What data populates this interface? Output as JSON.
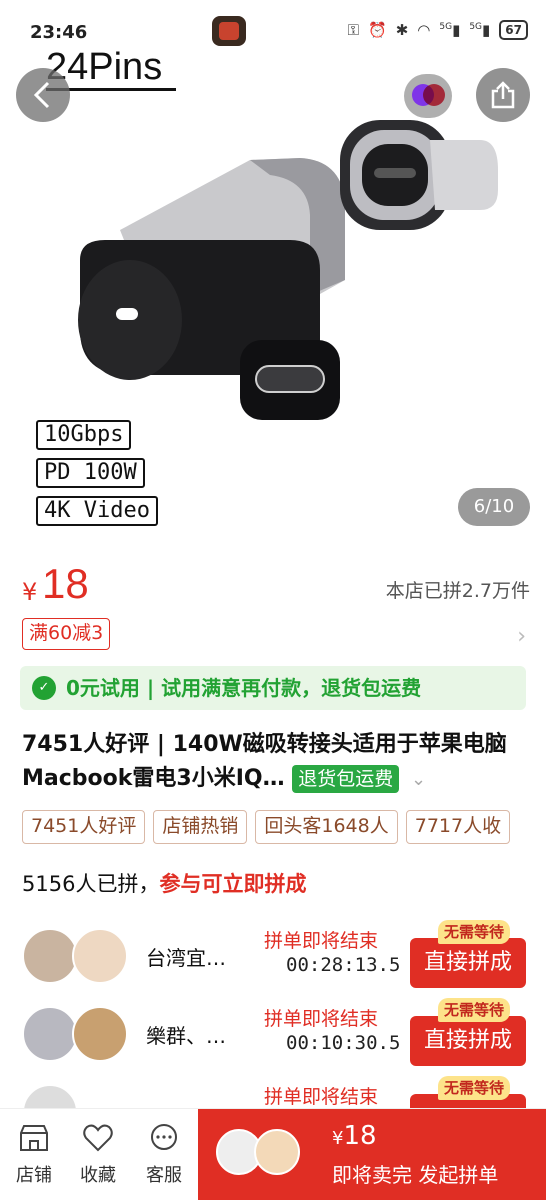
{
  "status_bar": {
    "time": "23:46",
    "battery": "67",
    "net1": "5G",
    "net2": "5G"
  },
  "gallery": {
    "overlay_title": "24Pins",
    "specs": [
      "10Gbps",
      "PD 100W",
      "4K Video"
    ],
    "pager": "6/10"
  },
  "price": {
    "currency": "¥",
    "amount": "18",
    "sold": "本店已拼2.7万件"
  },
  "coupon": "满60减3",
  "trial": {
    "label": "0元试用 | 试用满意再付款，退货包运费"
  },
  "product": {
    "title": "7451人好评 | 140W磁吸转接头适用于苹果电脑Macbook雷电3小米IQ…",
    "return_tag": "退货包运费"
  },
  "tags": [
    "7451人好评",
    "店铺热销",
    "回头客1648人",
    "7717人收"
  ],
  "group": {
    "count_text": "5156人已拼，",
    "cta_text": "参与可立即拼成",
    "rows": [
      {
        "name": "台湾宜…",
        "ending": "拼单即将结束",
        "timer": "00:28:13.5",
        "button": "直接拼成",
        "badge": "无需等待"
      },
      {
        "name": "樂群、…",
        "ending": "拼单即将结束",
        "timer": "00:10:30.5",
        "button": "直接拼成",
        "badge": "无需等待"
      },
      {
        "name": "",
        "ending": "拼单即将结束",
        "timer": "",
        "button": "",
        "badge": "无需等待"
      }
    ]
  },
  "bottom_bar": {
    "store": "店铺",
    "favorite": "收藏",
    "service": "客服",
    "buy_currency": "¥",
    "buy_price": "18",
    "buy_text": "即将卖完 发起拼单"
  },
  "colors": {
    "accent": "#e02e24",
    "green": "#22a233"
  }
}
